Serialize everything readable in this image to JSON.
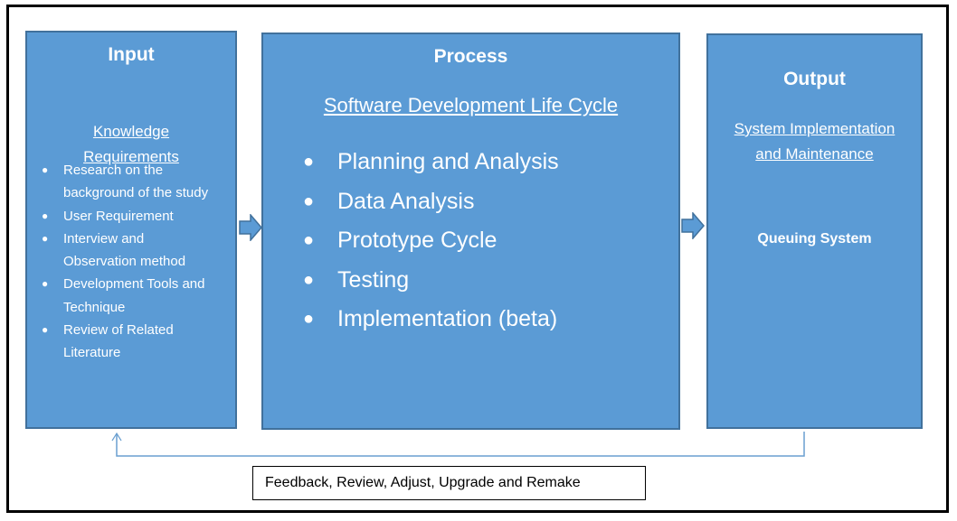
{
  "diagram": {
    "input": {
      "title": "Input",
      "subtitle_line1": "Knowledge",
      "subtitle_line2": "Requirements",
      "items": [
        {
          "line1": "Research on the",
          "line2": "background of the study"
        },
        {
          "line1": "User Requirement",
          "line2": ""
        },
        {
          "line1": "Interview and",
          "line2": "Observation method"
        },
        {
          "line1": "Development Tools and",
          "line2": "Technique"
        },
        {
          "line1": "Review of Related",
          "line2": "Literature"
        }
      ]
    },
    "process": {
      "title": "Process",
      "subtitle": "Software Development Life Cycle",
      "items": [
        "Planning and Analysis",
        "Data Analysis",
        "Prototype Cycle",
        "Testing",
        "Implementation (beta)"
      ]
    },
    "output": {
      "title": "Output",
      "subtitle_line1": "System Implementation",
      "subtitle_line2": "and Maintenance",
      "result": "Queuing System"
    },
    "feedback": {
      "label": "Feedback, Review, Adjust, Upgrade and Remake"
    },
    "bullet_glyph": "●",
    "colors": {
      "box_fill": "#5b9bd5",
      "box_border": "#41719c",
      "connector": "#6a9fd0"
    }
  }
}
